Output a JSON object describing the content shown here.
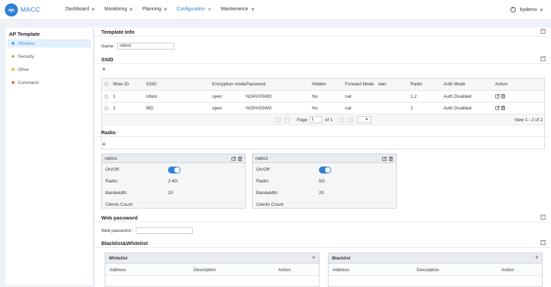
{
  "brand": "MACC",
  "nav": [
    {
      "label": "Dashboard",
      "active": false
    },
    {
      "label": "Monitoring",
      "active": false
    },
    {
      "label": "Planning",
      "active": false
    },
    {
      "label": "Configuration",
      "active": true
    },
    {
      "label": "Maintenance",
      "active": false
    }
  ],
  "user": "bydemo",
  "left": {
    "title": "AP Template",
    "items": [
      {
        "label": "Wireless",
        "color": "#3aa0e8",
        "selected": true
      },
      {
        "label": "Security",
        "color": "#9ec23a",
        "selected": false
      },
      {
        "label": "Other",
        "color": "#f0b21c",
        "selected": false
      },
      {
        "label": "Command",
        "color": "#ee5a2f",
        "selected": false
      }
    ]
  },
  "template_info": {
    "title": "Template Info",
    "name_label": "Name:",
    "name_value": "rdtest"
  },
  "ssid": {
    "title": "SSID",
    "columns": [
      "Wlan ID",
      "SSID",
      "Encryption mode",
      "Password",
      "Hidden",
      "Forward Mode",
      "vlan",
      "Radio",
      "Auth Mode",
      "Action"
    ],
    "rows": [
      [
        "1",
        "rdtest",
        "open",
        "NOPASSWD",
        "No",
        "nat",
        "",
        "1,2",
        "Auth Disabled"
      ],
      [
        "2",
        "IBD",
        "open",
        "NOPASSWD",
        "No",
        "nat",
        "",
        "1",
        "Auth Disabled"
      ]
    ],
    "pager": {
      "page_label": "Page",
      "page_value": "1",
      "of_label": "of 1",
      "view_text": "View 1 - 2 of 2"
    }
  },
  "radio": {
    "title": "Radio",
    "cards": [
      {
        "title": "radio1",
        "onoff_label": "On/Off:",
        "radio_label": "Radio:",
        "radio_value": "2.4G",
        "bandwidth_label": "Bandwidth:",
        "bandwidth_value": "20",
        "clients_label": "Clients Count:",
        "enabled": true
      },
      {
        "title": "radio2",
        "onoff_label": "On/Off:",
        "radio_label": "Radio:",
        "radio_value": "5G",
        "bandwidth_label": "Bandwidth:",
        "bandwidth_value": "20",
        "clients_label": "Clients Count:",
        "enabled": true
      }
    ]
  },
  "web_password": {
    "title": "Web password",
    "label": "Web password :",
    "value": ""
  },
  "blacklist": {
    "title": "Blacklist&Whitelist",
    "whitelist": {
      "title": "Whitelist",
      "columns": [
        "Address",
        "Description",
        "Action"
      ]
    },
    "blacklist": {
      "title": "Blacklist",
      "columns": [
        "Address",
        "Description",
        "Action"
      ]
    }
  }
}
